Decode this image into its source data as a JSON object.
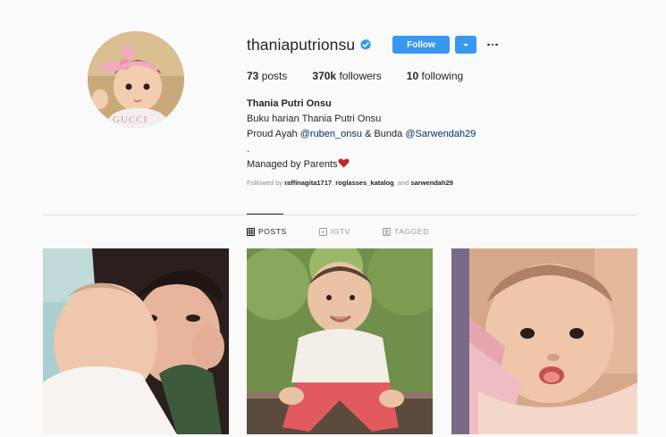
{
  "profile": {
    "username": "thaniaputrionsu",
    "verified": true,
    "follow_label": "Follow",
    "stats": {
      "posts_count": "73",
      "posts_label": "posts",
      "followers_count": "370k",
      "followers_label": "followers",
      "following_count": "10",
      "following_label": "following"
    },
    "bio": {
      "full_name": "Thania Putri Onsu",
      "line1": "Buku harian Thania Putri Onsu",
      "line2_prefix": "Proud Ayah ",
      "mention1": "@ruben_onsu",
      "line2_middle": " & Bunda ",
      "mention2": "@Sarwendah29",
      "dot": ".",
      "line4": "Managed by Parents"
    },
    "followed_by": {
      "prefix": "Followed by ",
      "user1": "raffinagita1717",
      "sep": ", ",
      "user2": "roglasses_katalog",
      "and": ", and ",
      "user3": "sarwendah29"
    }
  },
  "tabs": [
    {
      "label": "POSTS",
      "active": true
    },
    {
      "label": "IGTV",
      "active": false
    },
    {
      "label": "TAGGED",
      "active": false
    }
  ],
  "colors": {
    "accent": "#3897f0",
    "link": "#003569",
    "heart": "#c0272d"
  }
}
